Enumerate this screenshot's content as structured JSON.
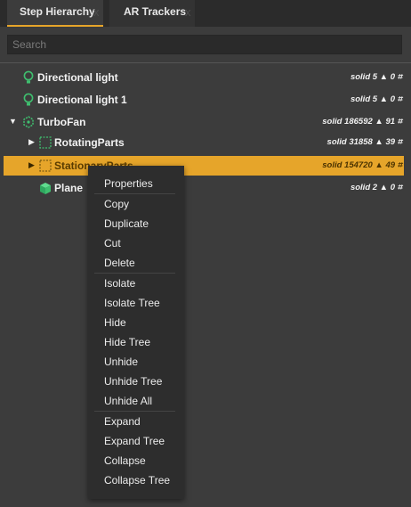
{
  "tabs": [
    {
      "label": "Step Hierarchy",
      "close": "x",
      "active": true
    },
    {
      "label": "AR Trackers",
      "close": "x",
      "active": false
    }
  ],
  "search": {
    "placeholder": "Search"
  },
  "tree": [
    {
      "name": "Directional light",
      "icon": "bulb-icon",
      "stats": "solid 5 ▲ 0 ⌗"
    },
    {
      "name": "Directional light 1",
      "icon": "bulb-icon",
      "stats": "solid 5 ▲ 0 ⌗"
    },
    {
      "name": "TurboFan",
      "icon": "assembly-icon",
      "stats": "solid 186592 ▲ 91 ⌗",
      "expanded": true
    },
    {
      "name": "RotatingParts",
      "icon": "group-box-icon",
      "stats": "solid 31858 ▲ 39 ⌗",
      "expanded": false
    },
    {
      "name": "StationaryParts",
      "icon": "group-box-icon",
      "stats": "solid 154720 ▲ 49 ⌗",
      "expanded": false,
      "selected": true
    },
    {
      "name": "Plane",
      "icon": "cube-icon",
      "stats": "solid 2 ▲ 0 ⌗"
    }
  ],
  "context_menu": {
    "items": [
      "Properties",
      "Copy",
      "Duplicate",
      "Cut",
      "Delete",
      "Isolate",
      "Isolate Tree",
      "Hide",
      "Hide Tree",
      "Unhide",
      "Unhide Tree",
      "Unhide All",
      "Expand",
      "Expand Tree",
      "Collapse",
      "Collapse Tree"
    ]
  },
  "colors": {
    "accent": "#e6a52a",
    "green_icon": "#3fbf6f",
    "panel": "#3c3c3c"
  }
}
